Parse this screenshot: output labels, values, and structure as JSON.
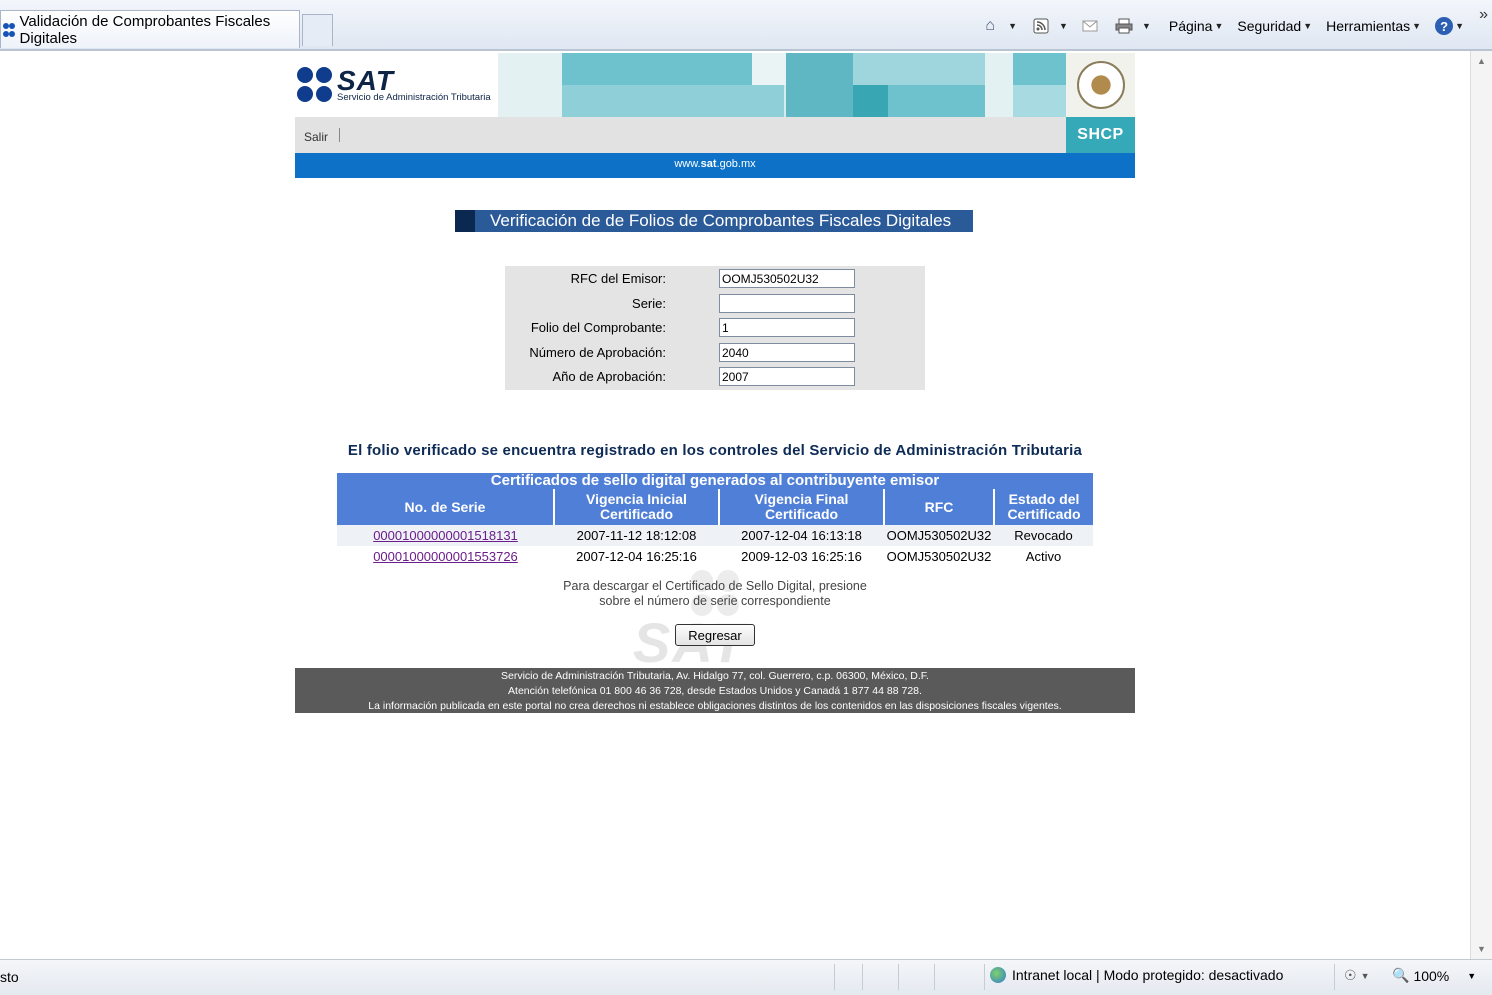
{
  "browser": {
    "tab_title": "Validación de Comprobantes Fiscales Digitales",
    "commands": {
      "page": "Página",
      "security": "Seguridad",
      "tools": "Herramientas",
      "more": "»"
    },
    "status": {
      "left_text": "sto",
      "zone": "Intranet local | Modo protegido: desactivado",
      "zoom": "100%"
    }
  },
  "header": {
    "logo_text": "SAT",
    "logo_subtitle": "Servicio de Administración Tributaria",
    "logout_label": "Salir",
    "shcp_label": "SHCP",
    "url_prefix": "www.",
    "url_bold": "sat",
    "url_suffix": ".gob.mx"
  },
  "page_title": "Verificación de de Folios de Comprobantes Fiscales Digitales",
  "form": {
    "rfc_label": "RFC del Emisor:",
    "rfc_value": "OOMJ530502U32",
    "serie_label": "Serie:",
    "serie_value": "",
    "folio_label": "Folio del Comprobante:",
    "folio_value": "1",
    "numero_label": "Número de Aprobación:",
    "numero_value": "2040",
    "anio_label": "Año de Aprobación:",
    "anio_value": "2007"
  },
  "result_message": "El folio verificado se encuentra registrado en los controles del Servicio de Administración Tributaria",
  "certificates": {
    "caption": "Certificados de sello digital generados al contribuyente emisor",
    "headers": {
      "serie": "No. de Serie",
      "vig_ini_1": "Vigencia Inicial",
      "vig_ini_2": "Certificado",
      "vig_fin_1": "Vigencia Final",
      "vig_fin_2": "Certificado",
      "rfc": "RFC",
      "estado_1": "Estado del",
      "estado_2": "Certificado"
    },
    "rows": [
      {
        "serie": "00001000000001518131",
        "inicio": "2007-11-12 18:12:08",
        "fin": "2007-12-04 16:13:18",
        "rfc": "OOMJ530502U32",
        "estado": "Revocado"
      },
      {
        "serie": "00001000000001553726",
        "inicio": "2007-12-04 16:25:16",
        "fin": "2009-12-03 16:25:16",
        "rfc": "OOMJ530502U32",
        "estado": "Activo"
      }
    ]
  },
  "hint": {
    "line1": "Para descargar el Certificado de Sello Digital, presione",
    "line2": "sobre el número de serie correspondiente"
  },
  "back_button": "Regresar",
  "watermark_text": "SAT",
  "footer": {
    "line1": "Servicio de Administración Tributaria, Av. Hidalgo 77, col. Guerrero, c.p. 06300, México, D.F.",
    "line2": "Atención telefónica 01 800 46 36 728, desde Estados Unidos y Canadá 1 877 44 88 728.",
    "line3": "La información publicada en este portal no crea derechos ni establece obligaciones distintos de los contenidos en las disposiciones fiscales vigentes."
  }
}
